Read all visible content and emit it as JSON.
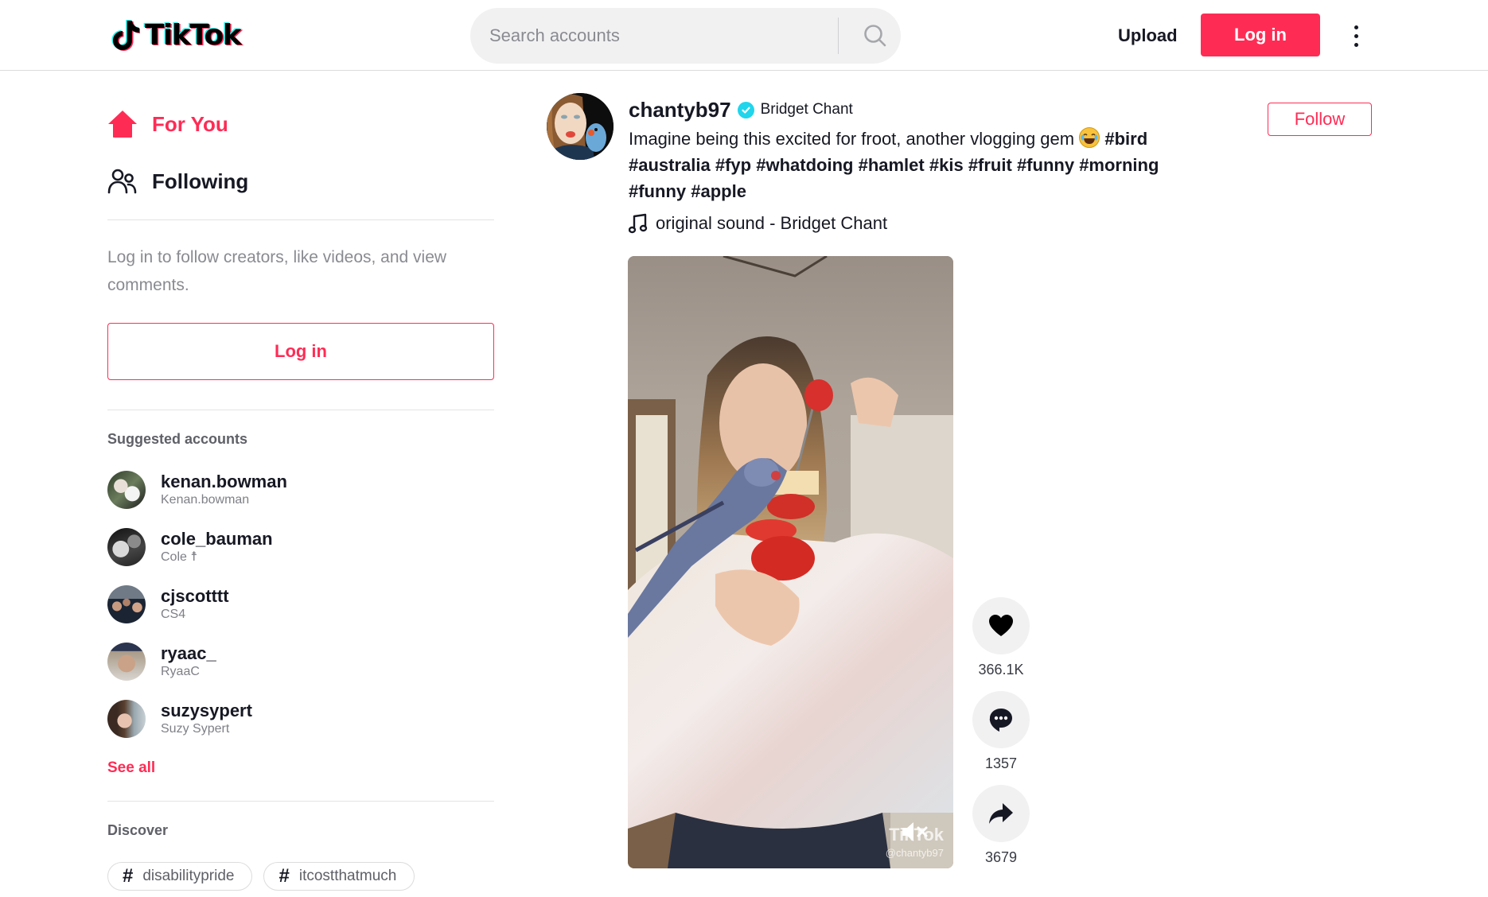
{
  "header": {
    "logo_text": "TikTok",
    "search_placeholder": "Search accounts",
    "upload_label": "Upload",
    "login_label": "Log in"
  },
  "sidebar": {
    "nav": [
      {
        "label": "For You",
        "icon": "home-icon",
        "active": true
      },
      {
        "label": "Following",
        "icon": "users-icon",
        "active": false
      }
    ],
    "login_hint": "Log in to follow creators, like videos, and view comments.",
    "login_button": "Log in",
    "suggested_title": "Suggested accounts",
    "suggested": [
      {
        "username": "kenan.bowman",
        "name": "Kenan.bowman"
      },
      {
        "username": "cole_bauman",
        "name": "Cole ☨"
      },
      {
        "username": "cjscotttt",
        "name": "CS4"
      },
      {
        "username": "ryaac_",
        "name": "RyaaC"
      },
      {
        "username": "suzysypert",
        "name": "Suzy Sypert"
      }
    ],
    "see_all": "See all",
    "discover_title": "Discover",
    "discover_tags": [
      "disabilitypride",
      "itcostthatmuch"
    ]
  },
  "post": {
    "username": "chantyb97",
    "verified": true,
    "nickname": "Bridget Chant",
    "caption_text": "Imagine being this excited for froot, another vlogging gem",
    "emoji": "face-with-tears-of-joy",
    "hashtags": [
      "#bird",
      "#australia",
      "#fyp",
      "#whatdoing",
      "#hamlet",
      "#kis",
      "#fruit",
      "#funny",
      "#morning",
      "#funny",
      "#apple"
    ],
    "music": "original sound - Bridget Chant",
    "follow_label": "Follow",
    "watermark_logo": "TikTok",
    "watermark_user": "@chantyb97",
    "muted": true,
    "actions": [
      {
        "icon": "heart-icon",
        "count": "366.1K"
      },
      {
        "icon": "comment-icon",
        "count": "1357"
      },
      {
        "icon": "share-icon",
        "count": "3679"
      }
    ]
  },
  "colors": {
    "brand": "#fe2c55",
    "verified": "#20d5ec",
    "text": "#161823",
    "muted_text": "#8a8b91"
  }
}
